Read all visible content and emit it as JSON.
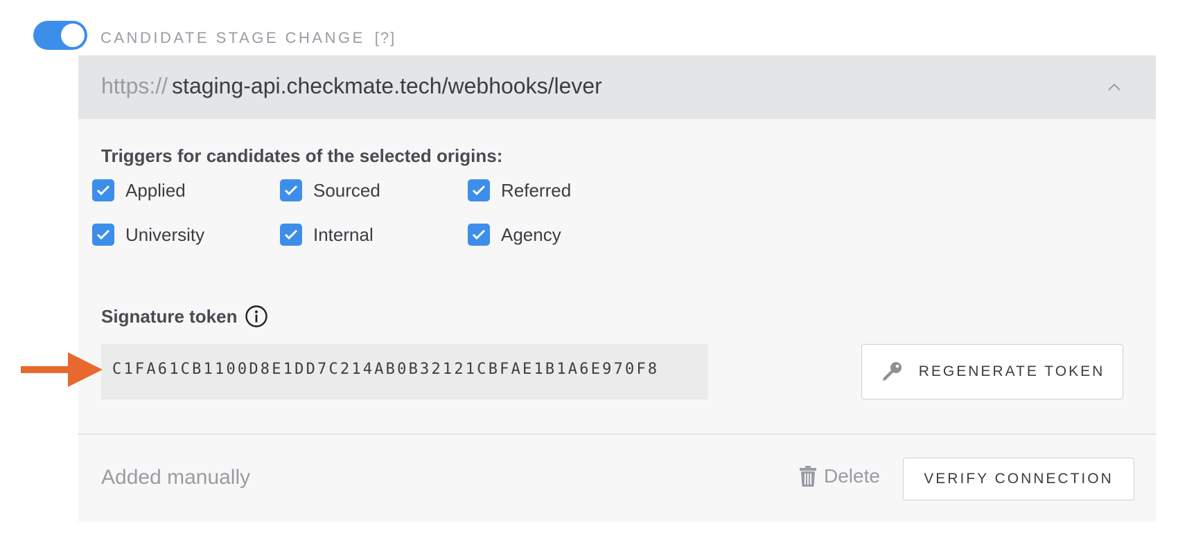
{
  "webhook": {
    "enabled": true,
    "title": "CANDIDATE STAGE CHANGE",
    "help": "[?]",
    "url_prefix": "https://",
    "url_host": "staging-api.checkmate.tech/webhooks/lever",
    "collapse_icon": "chevron-up-icon"
  },
  "triggers": {
    "label": "Triggers for candidates of the selected origins:",
    "options": [
      {
        "label": "Applied",
        "checked": true
      },
      {
        "label": "Sourced",
        "checked": true
      },
      {
        "label": "Referred",
        "checked": true
      },
      {
        "label": "University",
        "checked": true
      },
      {
        "label": "Internal",
        "checked": true
      },
      {
        "label": "Agency",
        "checked": true
      }
    ]
  },
  "signature": {
    "label": "Signature token",
    "info_icon": "info-icon",
    "token": "C1FA61CB1100D8E1DD7C214AB0B32121CBFAE1B1A6E970F8",
    "regenerate_label": "REGENERATE TOKEN",
    "regenerate_icon": "key-icon"
  },
  "footer": {
    "source": "Added manually",
    "delete_label": "Delete",
    "delete_icon": "trash-icon",
    "verify_label": "VERIFY CONNECTION"
  },
  "colors": {
    "accent": "#3d8eea",
    "annotation_arrow": "#e8692e"
  },
  "annotation": {
    "icon": "arrow-right-icon"
  }
}
